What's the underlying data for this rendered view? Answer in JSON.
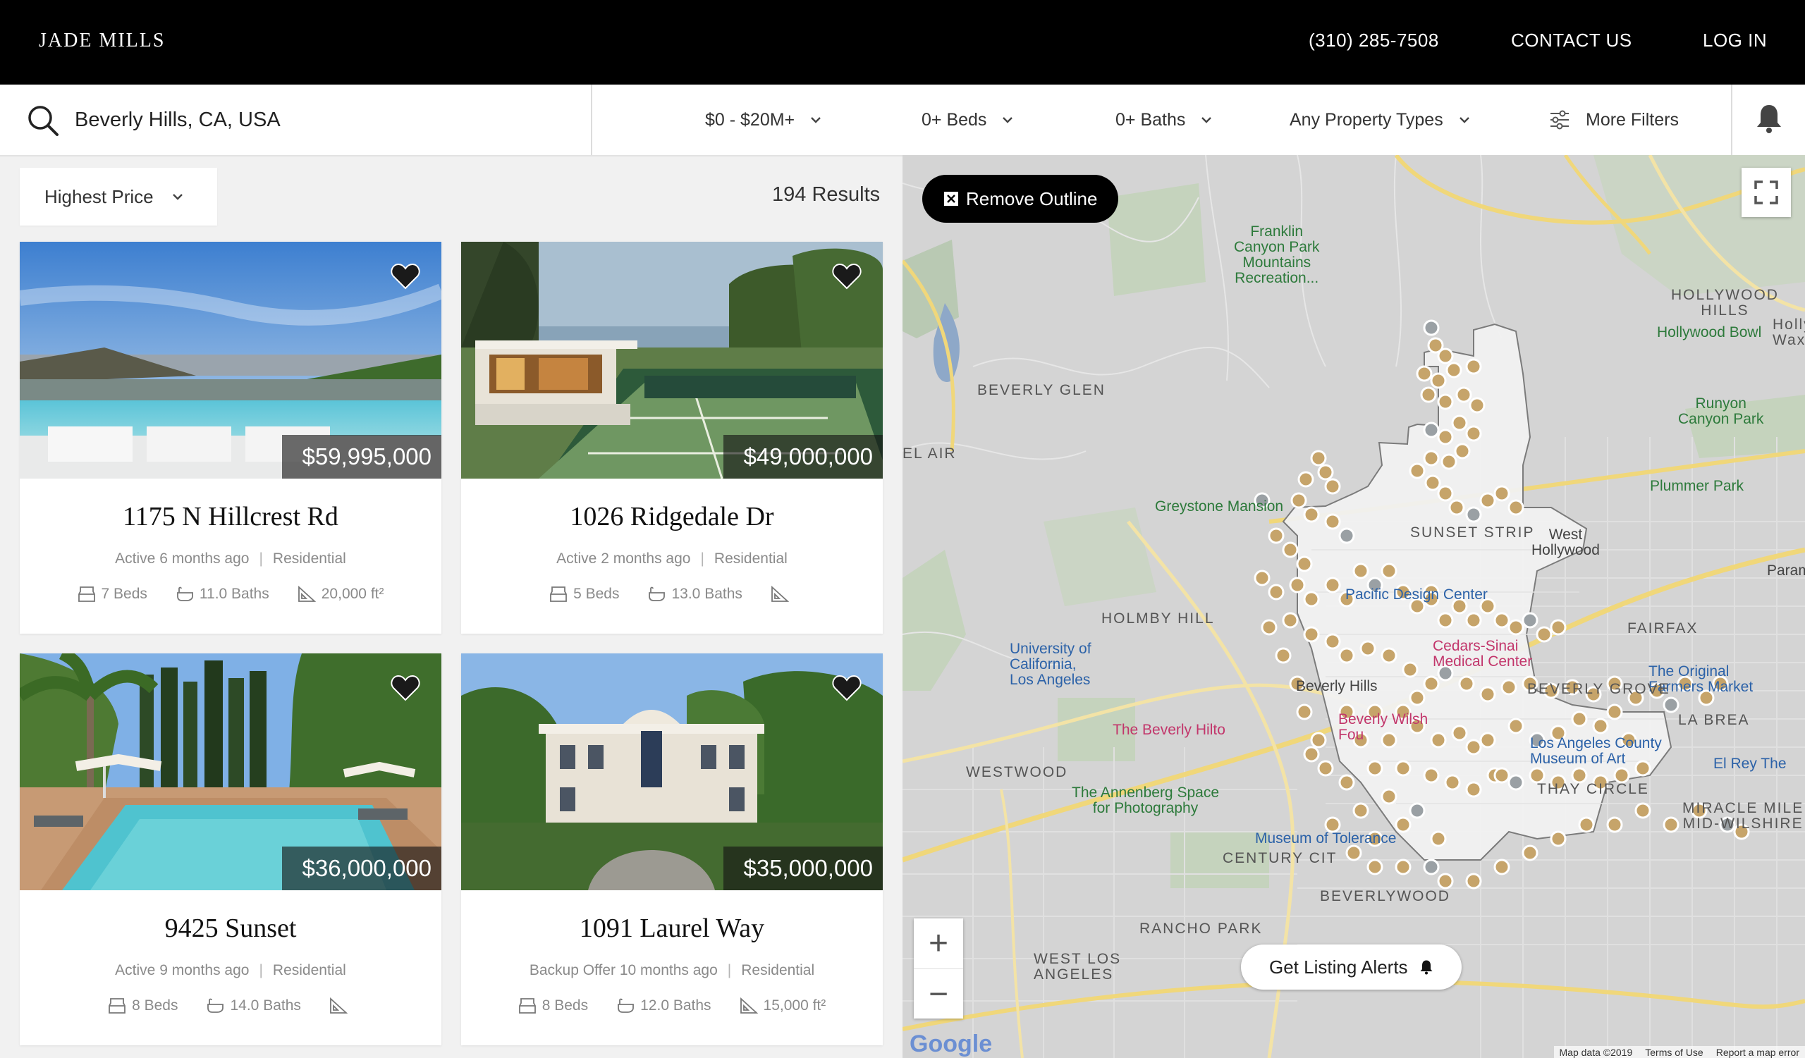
{
  "header": {
    "brand": "JADE MILLS",
    "phone": "(310) 285-7508",
    "contact": "CONTACT US",
    "login": "LOG IN"
  },
  "filters": {
    "search_value": "Beverly Hills, CA, USA",
    "price": "$0 - $20M+",
    "beds": "0+ Beds",
    "baths": "0+ Baths",
    "property_types": "Any Property Types",
    "more_filters": "More Filters"
  },
  "list": {
    "sort": "Highest Price",
    "results": "194 Results"
  },
  "listings": [
    {
      "price": "$59,995,000",
      "address": "1175 N Hillcrest Rd",
      "status": "Active 6 months ago",
      "type": "Residential",
      "beds": "7 Beds",
      "baths": "11.0 Baths",
      "area": "20,000 ft²"
    },
    {
      "price": "$49,000,000",
      "address": "1026 Ridgedale Dr",
      "status": "Active 2 months ago",
      "type": "Residential",
      "beds": "5 Beds",
      "baths": "13.0 Baths",
      "area": ""
    },
    {
      "price": "$36,000,000",
      "address": "9425 Sunset",
      "status": "Active 9 months ago",
      "type": "Residential",
      "beds": "8 Beds",
      "baths": "14.0 Baths",
      "area": ""
    },
    {
      "price": "$35,000,000",
      "address": "1091 Laurel Way",
      "status": "Backup Offer 10 months ago",
      "type": "Residential",
      "beds": "8 Beds",
      "baths": "12.0 Baths",
      "area": "15,000 ft²"
    }
  ],
  "map": {
    "remove_outline": "Remove Outline",
    "get_alerts": "Get Listing Alerts",
    "zoom_in": "+",
    "zoom_out": "−",
    "google": "Google",
    "footer": [
      "Map data ©2019",
      "Terms of Use",
      "Report a map error"
    ],
    "labels": {
      "franklin": "Franklin\nCanyon Park\nMountains\nRecreation...",
      "beverly_glen": "BEVERLY GLEN",
      "bel_air": "EL AIR",
      "greystone": "Greystone Mansion",
      "holmby": "HOLMBY HILL",
      "ucla": "University of\nCalifornia,\nLos Angeles",
      "beverly_hilton": "The Beverly Hilto",
      "westwood": "WESTWOOD",
      "annenberg": "The Annenberg Space\nfor Photography",
      "century_city": "CENTURY CIT",
      "museum_tolerance": "Museum of Tolerance",
      "beverlywood": "BEVERLYWOOD",
      "rancho_park": "RANCHO PARK",
      "west_la": "WEST LOS\nANGELES",
      "hollywood_hills": "HOLLYWOOD\nHILLS",
      "hollywood_bowl": "Hollywood Bowl",
      "runyon": "Runyon\nCanyon Park",
      "plummer": "Plummer Park",
      "sunset_strip": "SUNSET STRIP",
      "west_hollywood": "West\nHollywood",
      "pacific_design": "Pacific Design Center",
      "cedars": "Cedars-Sinai\nMedical Center",
      "fairfax": "FAIRFAX",
      "original_farmers": "The Original\nFarmers Market",
      "beverly_grove": "BEVERLY GROVE",
      "la_brea": "LA BREA",
      "lacma": "Los Angeles County\nMuseum of Art",
      "el_rey": "El Rey The",
      "thay_circle": "THAY CIRCLE",
      "miracle_mile": "MIRACLE MILE\nMID-WILSHIRE",
      "holly_wax": "Holly\nWax",
      "param": "Param",
      "beverly_hills_label": "Beverly Hills",
      "four_seasons": "Beverly Wilsh\nFou"
    }
  },
  "colors": {
    "accent": "#000000",
    "pin": "#c6a46a",
    "pin_gray": "#9aa0a4",
    "outline_fill": "#f2f2f2"
  }
}
